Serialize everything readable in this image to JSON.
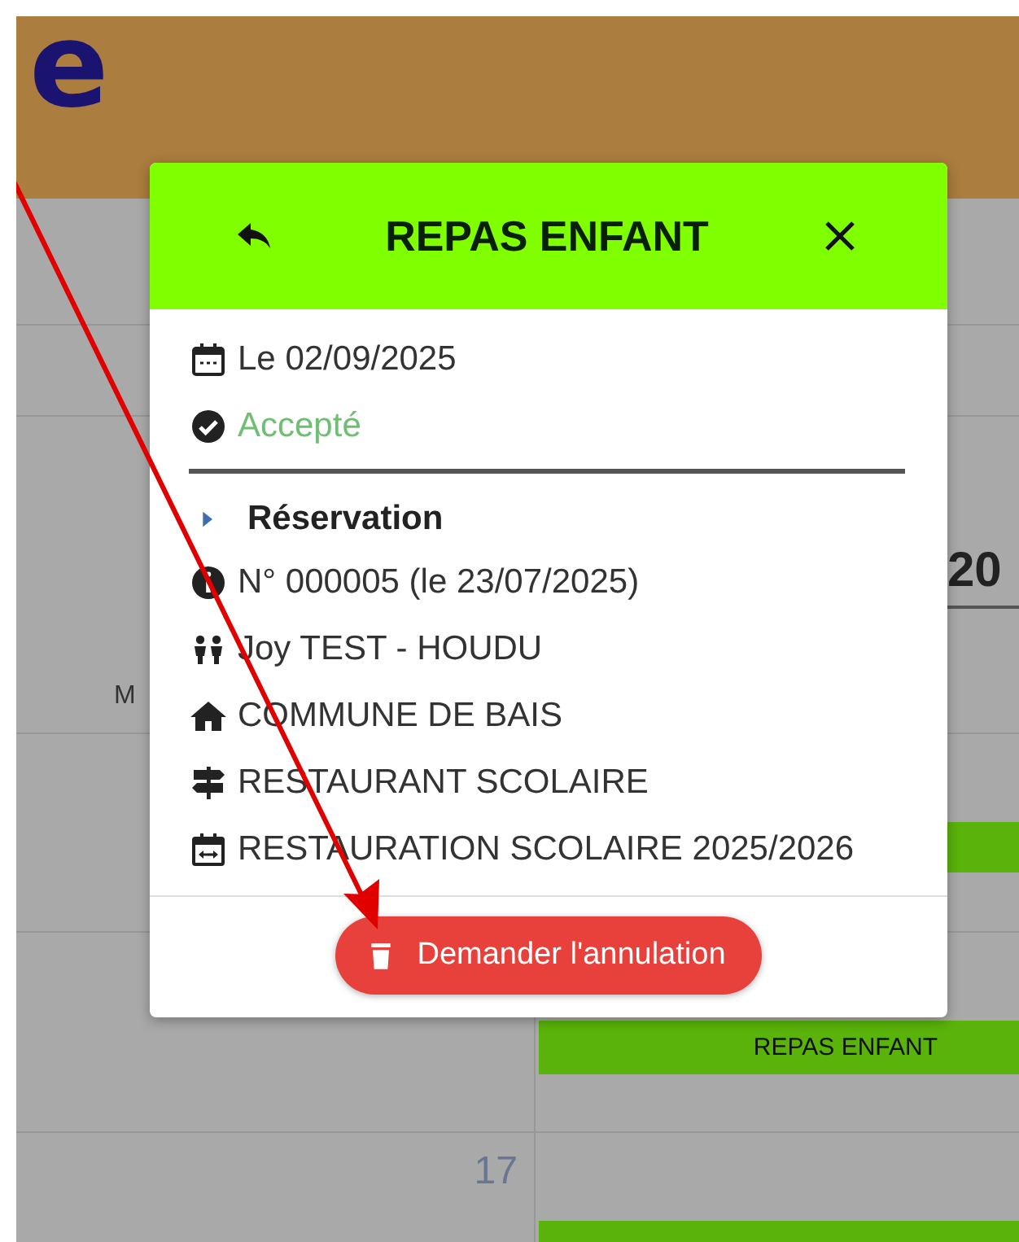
{
  "header": {
    "logo_text": "e"
  },
  "calendar": {
    "year_heading": "20",
    "column_heading": "M",
    "day_number": "17",
    "entries": [
      {
        "kind": "event"
      },
      {
        "kind": "event",
        "label": "REPAS ENFANT"
      },
      {
        "kind": "event"
      }
    ]
  },
  "dialog": {
    "title": "REPAS ENFANT",
    "date": "Le 02/09/2025",
    "status": {
      "kind": "accepted",
      "label": "Accepté"
    },
    "section_title": "Réservation",
    "details": [
      {
        "kind": "info",
        "text": "N° 000005 (le 23/07/2025)"
      },
      {
        "kind": "people",
        "text": "Joy TEST - HOUDU"
      },
      {
        "kind": "home",
        "text": "COMMUNE DE BAIS"
      },
      {
        "kind": "signpost",
        "text": "RESTAURANT SCOLAIRE"
      },
      {
        "kind": "period",
        "text": "RESTAURATION SCOLAIRE 2025/2026"
      }
    ],
    "action": "Demander l'annulation"
  }
}
